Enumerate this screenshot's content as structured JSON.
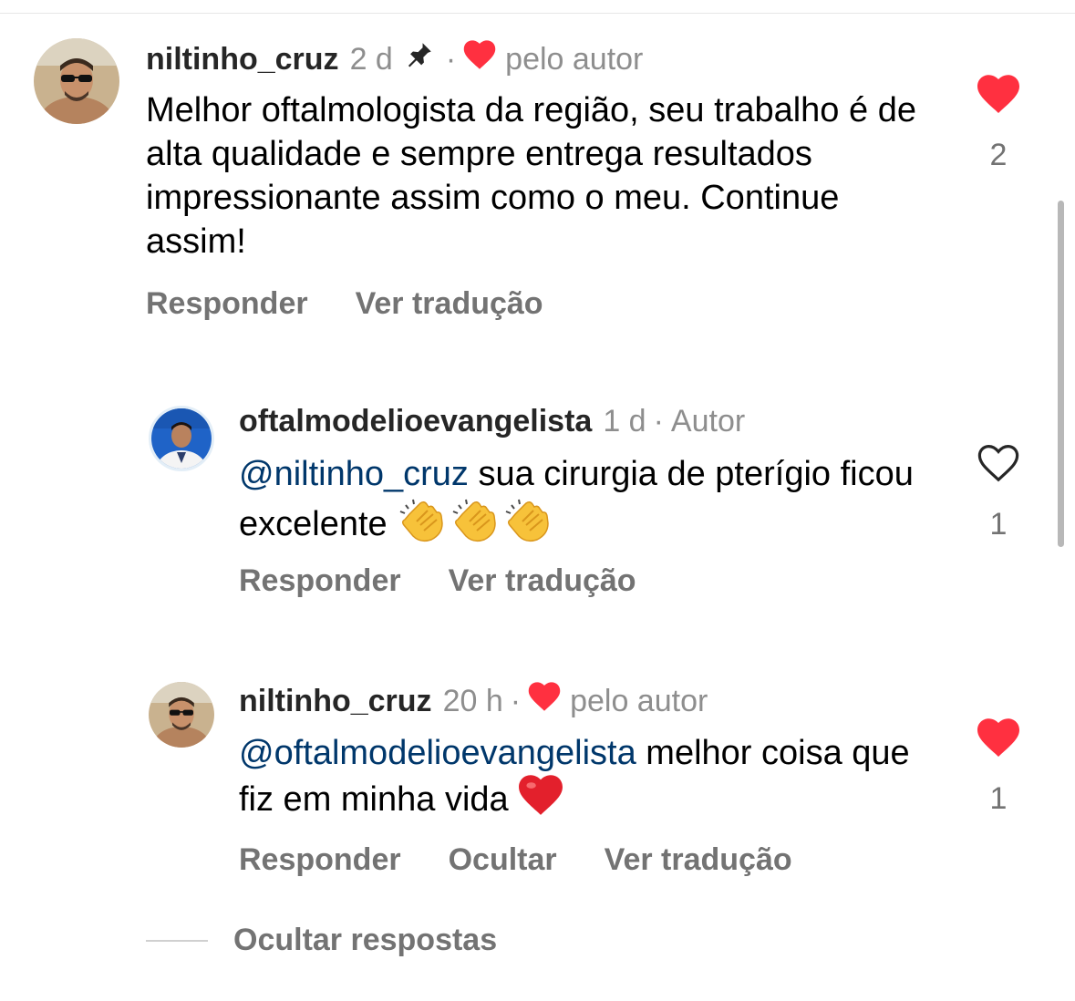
{
  "comments": [
    {
      "username": "niltinho_cruz",
      "time": "2 d",
      "liked_by_author_label": "pelo autor",
      "text": "Melhor oftalmologista da região, seu trabalho é de alta qualidade e sempre entrega resultados impressionante assim como o meu. Continue assim!",
      "actions": [
        "Responder",
        "Ver tradução"
      ],
      "likes": "2",
      "liked": true
    },
    {
      "username": "oftalmodelioevangelista",
      "time": "1 d",
      "role": "Autor",
      "mention": "@niltinho_cruz",
      "text": " sua cirurgia de pterígio ficou excelente ",
      "actions": [
        "Responder",
        "Ver tradução"
      ],
      "likes": "1",
      "liked": false
    },
    {
      "username": "niltinho_cruz",
      "time": "20 h",
      "liked_by_author_label": "pelo autor",
      "mention": "@oftalmodelioevangelista",
      "text": " melhor coisa que fiz em minha vida ",
      "actions": [
        "Responder",
        "Ocultar",
        "Ver tradução"
      ],
      "likes": "1",
      "liked": true
    }
  ],
  "hide_replies_label": "Ocultar respostas",
  "colors": {
    "like_red": "#ff3040",
    "mention": "#00376b",
    "muted": "#737373"
  }
}
